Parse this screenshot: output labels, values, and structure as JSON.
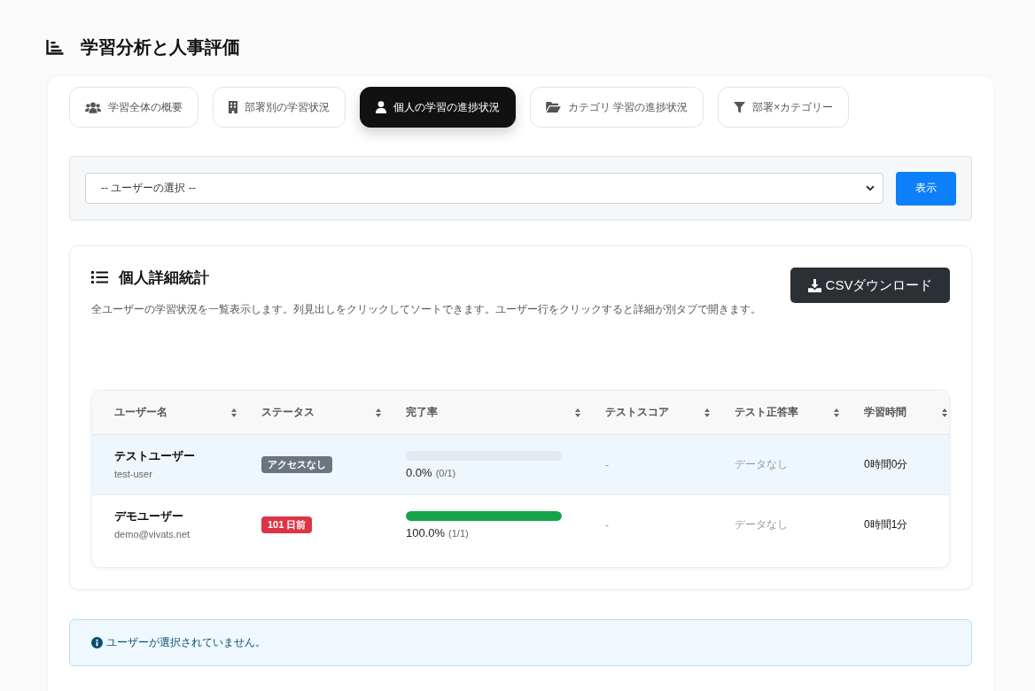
{
  "page_title": "学習分析と人事評価",
  "tabs": [
    {
      "label": "学習全体の概要",
      "selected": false
    },
    {
      "label": "部署別の学習状況",
      "selected": false
    },
    {
      "label": "個人の学習の進捗状況",
      "selected": true
    },
    {
      "label": "カテゴリ 学習の進捗状況",
      "selected": false
    },
    {
      "label": "部署×カテゴリー",
      "selected": false
    }
  ],
  "user_filter": {
    "select_value": "-- ユーザーの選択 --",
    "button": "表示"
  },
  "stats": {
    "title": "個人詳細統計",
    "download_button": "CSVダウンロード",
    "description": "全ユーザーの学習状況を一覧表示します。列見出しをクリックしてソートできます。ユーザー行をクリックすると詳細が別タブで開きます。",
    "table": {
      "columns": [
        "ユーザー名",
        "ステータス",
        "完了率",
        "テストスコア",
        "テスト正答率",
        "学習時間"
      ],
      "rows": [
        {
          "selected": true,
          "name": "テストユーザー",
          "login": "test-user",
          "status": {
            "label": "アクセスなし",
            "color": "#6c757d"
          },
          "completion": {
            "level": 0,
            "percent": "0.0%",
            "count": "(0/1)"
          },
          "test_score": "-",
          "test_accuracy": "データなし",
          "study_time": "0時間0分"
        },
        {
          "selected": false,
          "name": "デモユーザー",
          "login": "demo@vivats.net",
          "status": {
            "label": "101 日前",
            "color": "#dc3545"
          },
          "completion": {
            "level": 1,
            "percent": "100.0%",
            "count": "(1/1)"
          },
          "test_score": "-",
          "test_accuracy": "データなし",
          "study_time": "0時間1分"
        }
      ]
    }
  },
  "alert": {
    "message": "ユーザーが選択されていません。"
  }
}
